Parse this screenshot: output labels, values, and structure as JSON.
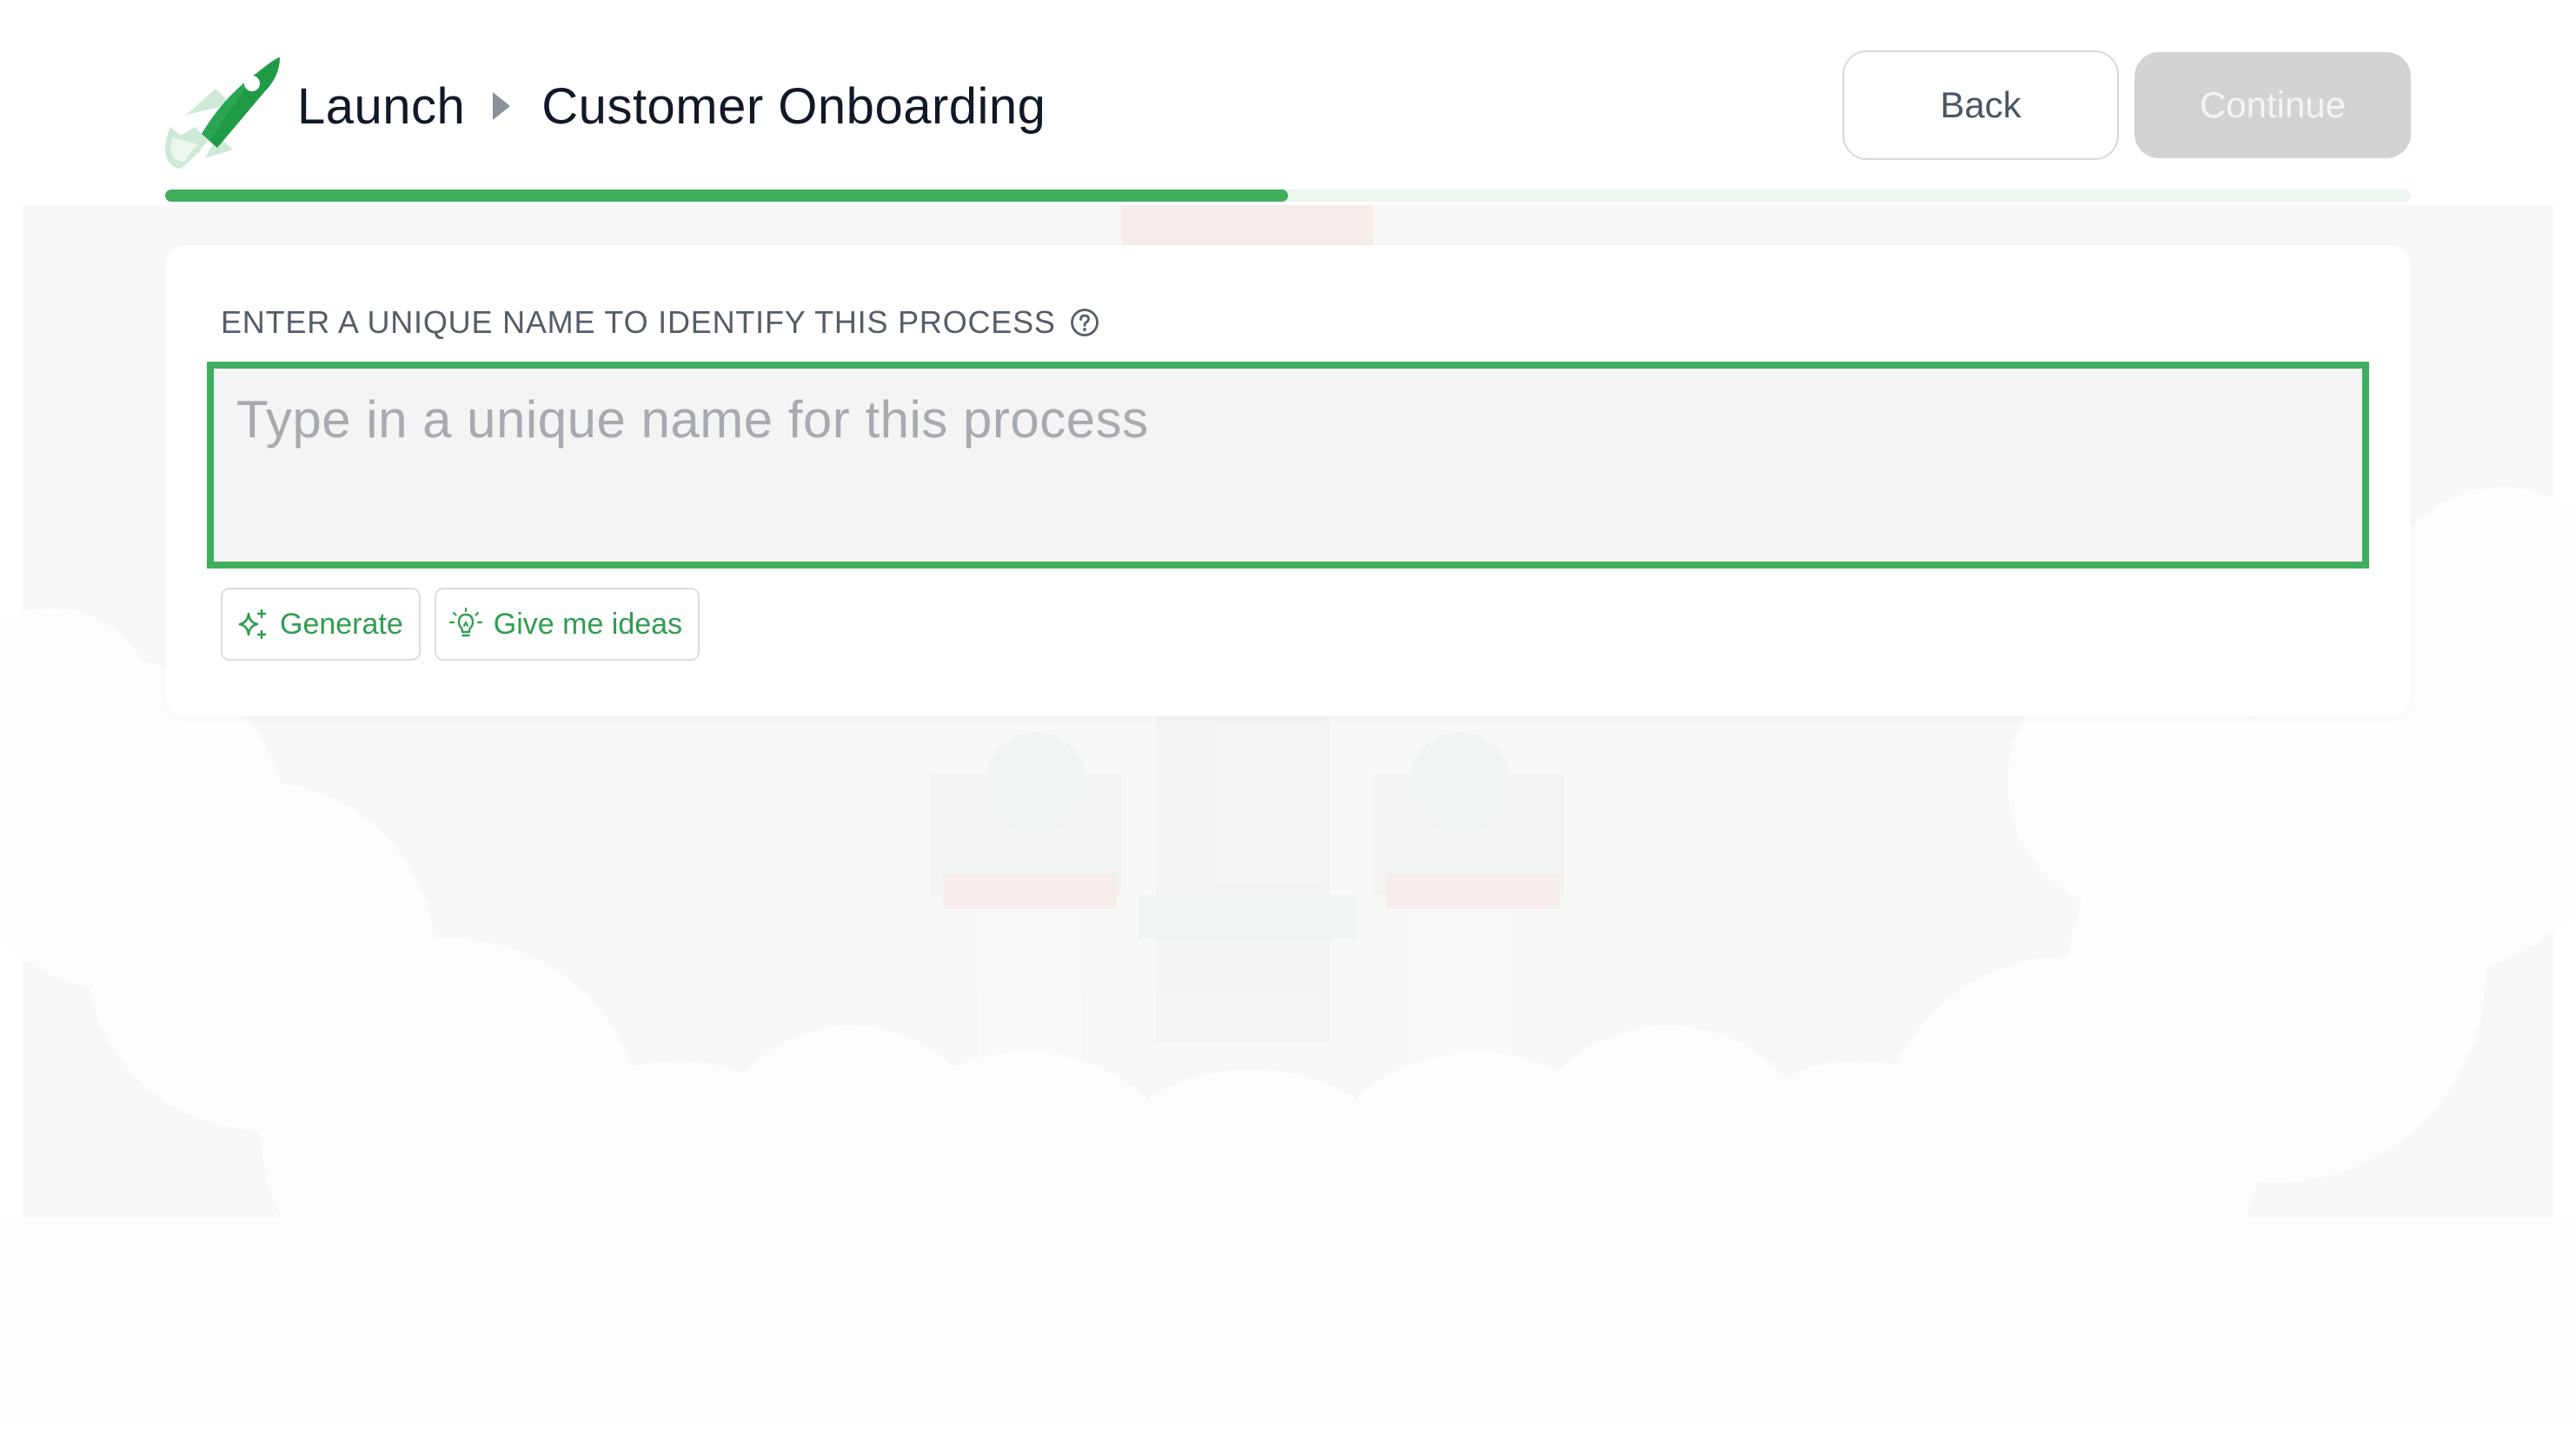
{
  "header": {
    "breadcrumb_root": "Launch",
    "breadcrumb_current": "Customer Onboarding",
    "back_label": "Back",
    "continue_label": "Continue",
    "continue_enabled": false
  },
  "progress": {
    "fraction": 0.5
  },
  "form": {
    "field_label": "ENTER A UNIQUE NAME TO IDENTIFY THIS PROCESS",
    "input_value": "",
    "input_placeholder": "Type in a unique name for this process",
    "actions": [
      {
        "label": "Generate",
        "icon": "sparkles-icon"
      },
      {
        "label": "Give me ideas",
        "icon": "lightbulb-icon"
      }
    ]
  },
  "icons": {
    "logo": "rocket-icon",
    "breadcrumb_separator": "caret-right-icon",
    "help": "question-circle-icon"
  },
  "colors": {
    "brand_green": "#3fae5d",
    "brand_green_dark": "#1f9a45",
    "brand_green_light": "#cfe9d7",
    "progress_track": "#eaf6ee",
    "input_background": "#f4f4f4",
    "disabled_button": "#d2d3d5"
  }
}
